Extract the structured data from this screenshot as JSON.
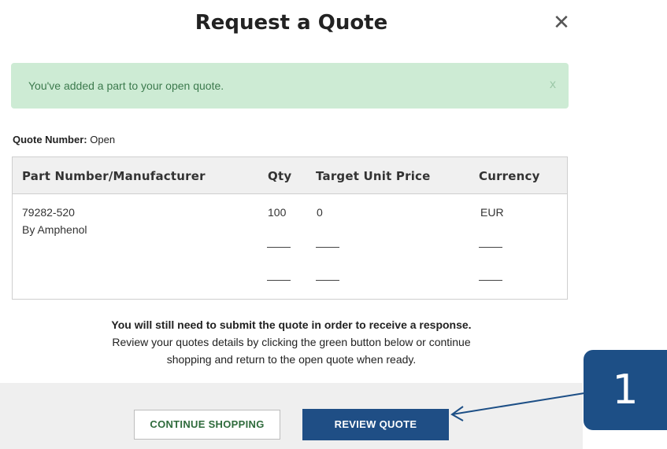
{
  "modal": {
    "title": "Request a Quote",
    "close_icon": "close-icon"
  },
  "alert": {
    "message": "You've added a part to your open quote.",
    "close_glyph": "x",
    "color": "#cdebd4"
  },
  "quote": {
    "number_label": "Quote Number:",
    "number_value": "Open"
  },
  "table": {
    "headers": [
      "Part Number/Manufacturer",
      "Qty",
      "Target Unit Price",
      "Currency"
    ],
    "rows": [
      {
        "part_number": "79282-520",
        "manufacturer": "By Amphenol",
        "qty": "100",
        "target_unit_price": "0",
        "currency": "EUR"
      }
    ]
  },
  "note": {
    "line1": "You will still need to submit the quote in order to receive a response.",
    "line2": "Review your quotes details by clicking the green button below or continue",
    "line3": "shopping and return to the open quote when ready."
  },
  "buttons": {
    "continue_shopping": "CONTINUE SHOPPING",
    "review_quote": "REVIEW QUOTE",
    "review_color": "#1f4e85"
  },
  "callout": {
    "number": "1",
    "color": "#1d4f86"
  }
}
